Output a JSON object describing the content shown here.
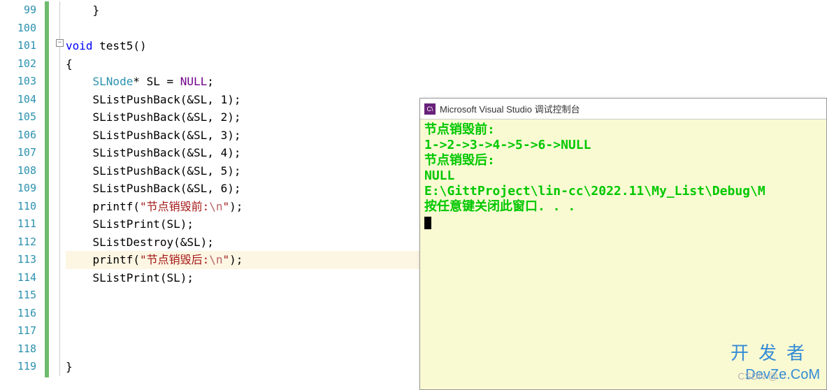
{
  "editor": {
    "lines_start": 99,
    "lines_end": 119,
    "current_line": 113,
    "code": {
      "l99": "    }",
      "l101_kw": "void",
      "l101_fn": " test5()",
      "l102": "{",
      "l103_indent": "    ",
      "l103_type": "SLNode",
      "l103_rest": "* SL = ",
      "l103_null": "NULL",
      "l103_semi": ";",
      "push_fn": "SListPushBack",
      "push_args": [
        "(&SL, 1);",
        "(&SL, 2);",
        "(&SL, 3);",
        "(&SL, 4);",
        "(&SL, 5);",
        "(&SL, 6);"
      ],
      "printf": "printf",
      "str1_a": "\"节点销毁前:",
      "str_esc": "\\n",
      "str_end": "\"",
      "print_fn": "SListPrint",
      "print_args": "(SL);",
      "destroy_fn": "SListDestroy",
      "destroy_args": "(&SL);",
      "str2_a": "\"节点销毁后:",
      "l119": "}"
    }
  },
  "console": {
    "title": "Microsoft Visual Studio 调试控制台",
    "lines": [
      "节点销毁前:",
      "1->2->3->4->5->6->NULL",
      "节点销毁后:",
      "NULL",
      "",
      "E:\\GittProject\\lin-cc\\2022.11\\My_List\\Debug\\M",
      "按任意键关闭此窗口. . ."
    ]
  },
  "watermark": {
    "w1": "开发者",
    "w2": "DevZe.CoM",
    "w3": "CSDN @"
  }
}
